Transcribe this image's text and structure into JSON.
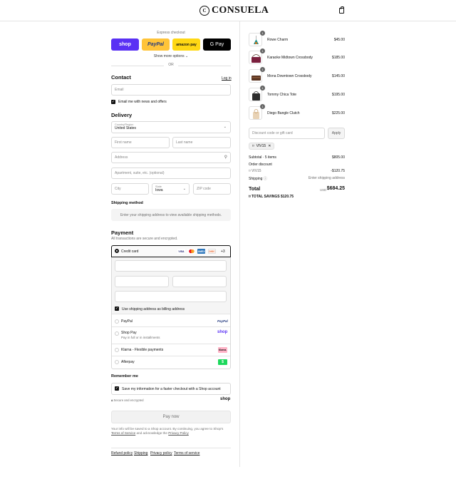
{
  "brand": {
    "name": "CONSUELA",
    "mark": "C"
  },
  "express": {
    "title": "Express checkout",
    "shop": "shop",
    "paypal": "PayPal",
    "amazon": "amazon pay",
    "gpay": "G Pay",
    "show_more": "Show more options",
    "or": "OR"
  },
  "contact": {
    "title": "Contact",
    "login": "Log in",
    "email_placeholder": "Email",
    "news_label": "Email me with news and offers"
  },
  "delivery": {
    "title": "Delivery",
    "country_label": "Country/Region",
    "country_value": "United States",
    "first_name": "First name",
    "last_name": "Last name",
    "address": "Address",
    "apartment": "Apartment, suite, etc. (optional)",
    "city": "City",
    "state_label": "State",
    "state_value": "Iowa",
    "zip": "ZIP code"
  },
  "shipping_method": {
    "title": "Shipping method",
    "notice": "Enter your shipping address to view available shipping methods."
  },
  "payment": {
    "title": "Payment",
    "subtitle": "All transactions are secure and encrypted.",
    "credit_card": "Credit card",
    "cards": [
      "VISA",
      "MC",
      "AMEX",
      "DISC"
    ],
    "more_cards": "+3",
    "billing_label": "Use shipping address as billing address",
    "methods": [
      {
        "name": "PayPal",
        "badge": "PayPal"
      },
      {
        "name": "Shop Pay",
        "sub": "Pay in full or in installments",
        "badge": "shop"
      },
      {
        "name": "Klarna - Flexible payments",
        "badge": "Klarna."
      },
      {
        "name": "Afterpay",
        "badge": "$"
      }
    ]
  },
  "remember": {
    "title": "Remember me",
    "label": "Save my information for a faster checkout with a Shop account",
    "secure": "Secure and encrypted",
    "shop": "shop"
  },
  "pay_now": "Pay now",
  "legal": {
    "line1": "Your info will be saved to a Shop account. By continuing, you agree to Shop's",
    "terms": "Terms of Service",
    "and": "and acknowledge the",
    "privacy": "Privacy Policy"
  },
  "footer_links": [
    "Refund policy",
    "Shipping",
    "Privacy policy",
    "Terms of service"
  ],
  "cart": {
    "items": [
      {
        "name": "Rowe Charm",
        "price": "$45.00",
        "qty": "1"
      },
      {
        "name": "Karaoke Midtown Crossbody",
        "price": "$185.00",
        "qty": "1"
      },
      {
        "name": "Mona Downtown Crossbody",
        "price": "$145.00",
        "qty": "1"
      },
      {
        "name": "Tommy Chica Tote",
        "price": "$195.00",
        "qty": "1"
      },
      {
        "name": "Diego Bangle Clutch",
        "price": "$225.00",
        "qty": "1"
      }
    ],
    "discount_placeholder": "Discount code or gift card",
    "apply": "Apply",
    "code": "VIV15",
    "subtotal_label": "Subtotal · 5 items",
    "subtotal": "$805.00",
    "order_discount_label": "Order discount",
    "discount_code": "VIV15",
    "discount_value": "-$120.75",
    "shipping_label": "Shipping",
    "shipping_value": "Enter shipping address",
    "total_label": "Total",
    "currency": "USD",
    "total": "$684.25",
    "savings_label": "TOTAL SAVINGS",
    "savings": "$120.75"
  }
}
